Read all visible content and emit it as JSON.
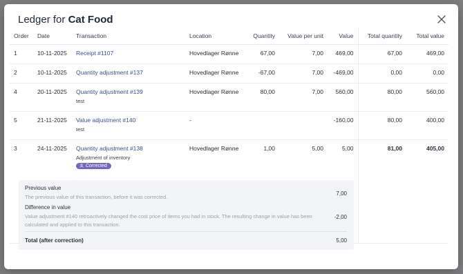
{
  "modal": {
    "title_prefix": "Ledger for",
    "title_item": "Cat Food"
  },
  "table": {
    "headers": {
      "order": "Order",
      "date": "Date",
      "transaction": "Transaction",
      "location": "Location",
      "quantity": "Quantity",
      "value_per_unit": "Value per unit",
      "value": "Value",
      "total_quantity": "Total quantity",
      "total_value": "Total value"
    },
    "rows": [
      {
        "order": "1",
        "date": "10-11-2025",
        "transaction": "Receipt #1107",
        "note": "",
        "location": "Hovedlager Rønne",
        "quantity": "67,00",
        "value_per_unit": "7,00",
        "value": "469,00",
        "total_quantity": "67,00",
        "total_value": "469,00"
      },
      {
        "order": "2",
        "date": "10-11-2025",
        "transaction": "Quantity adjustment #137",
        "note": "",
        "location": "Hovedlager Rønne",
        "quantity": "-67,00",
        "value_per_unit": "7,00",
        "value": "-469,00",
        "total_quantity": "0,00",
        "total_value": "0,00"
      },
      {
        "order": "4",
        "date": "20-11-2025",
        "transaction": "Quantity adjustment #139",
        "note": "test",
        "location": "Hovedlager Rønne",
        "quantity": "80,00",
        "value_per_unit": "7,00",
        "value": "560,00",
        "total_quantity": "80,00",
        "total_value": "560,00"
      },
      {
        "order": "5",
        "date": "21-11-2025",
        "transaction": "Value adjustment #140",
        "note": "test",
        "location": "-",
        "quantity": "",
        "value_per_unit": "",
        "value": "-160,00",
        "total_quantity": "80,00",
        "total_value": "400,00"
      },
      {
        "order": "3",
        "date": "24-11-2025",
        "transaction": "Quantity adjustment #138",
        "note": "Adjustment of inventory",
        "badge": "Corrected",
        "location": "Hovedlager Rønne",
        "quantity": "1,00",
        "value_per_unit": "5,00",
        "value": "5,00",
        "total_quantity": "81,00",
        "total_value": "405,00"
      }
    ]
  },
  "correction": {
    "previous_title": "Previous value",
    "previous_desc": "The previous value of this transaction, before it was corrected.",
    "previous_value": "7,00",
    "difference_title": "Difference in value",
    "difference_desc": "Value adjustment #140 retroactively changed the cost price of items you had in stock. The resulting change in value has been calculated and applied to this transaction.",
    "difference_value": "-2,00",
    "total_label": "Total (after correction)",
    "total_value": "5,00"
  },
  "colors": {
    "link": "#3b4f8c",
    "badge": "#7466b8",
    "panel": "#f2f4f7"
  },
  "icons": {
    "close": "close-icon",
    "badge": "user-icon"
  }
}
